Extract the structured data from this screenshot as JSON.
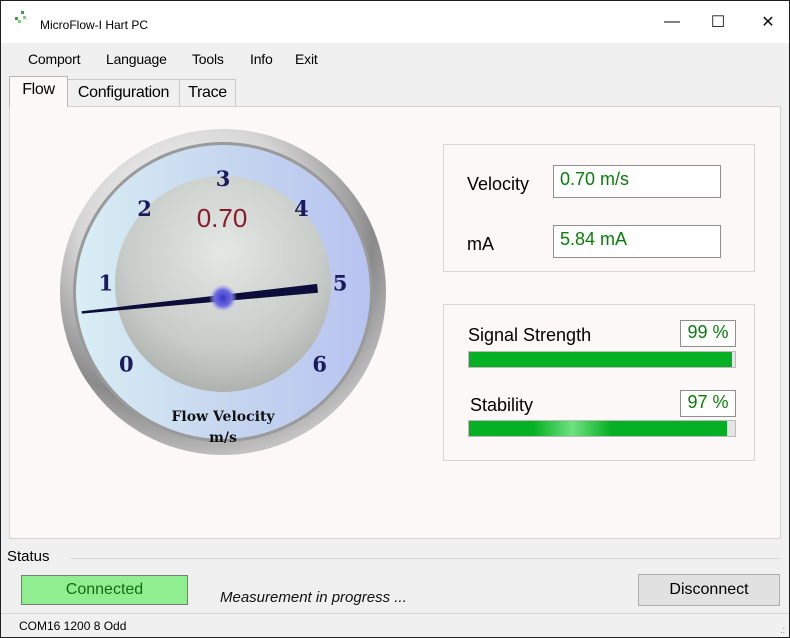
{
  "window": {
    "title": "MicroFlow-I Hart PC",
    "minimize_symbol": "—",
    "maximize_symbol": "☐",
    "close_symbol": "✕"
  },
  "menu": {
    "items": [
      "Comport",
      "Language",
      "Tools",
      "Info",
      "Exit"
    ]
  },
  "tabs": [
    {
      "label": "Flow",
      "active": true
    },
    {
      "label": "Configuration",
      "active": false
    },
    {
      "label": "Trace",
      "active": false
    }
  ],
  "gauge": {
    "digital_readout": "0.70",
    "value": 0.7,
    "ticks": [
      "0",
      "1",
      "2",
      "3",
      "4",
      "5",
      "6"
    ],
    "caption_line1": "Flow Velocity",
    "caption_line2": "m/s",
    "readout_color": "#8b1a2b",
    "tick_color": "#1a1a5e"
  },
  "readings": {
    "velocity_label": "Velocity",
    "velocity_value": "0.70 m/s",
    "ma_label": "mA",
    "ma_value": "5.84 mA"
  },
  "quality": {
    "signal_label": "Signal Strength",
    "signal_value": "99 %",
    "signal_level": 0.99,
    "stability_label": "Stability",
    "stability_value": "97 %",
    "stability_level": 0.97,
    "bar_color": "#06b025"
  },
  "status": {
    "group_title": "Status",
    "connection": "Connected",
    "message": "Measurement in progress ...",
    "disconnect_label": "Disconnect",
    "connected_color": "#90ee90"
  },
  "statusbar": {
    "text": "COM16 1200 8 Odd",
    "grip": ".:"
  }
}
